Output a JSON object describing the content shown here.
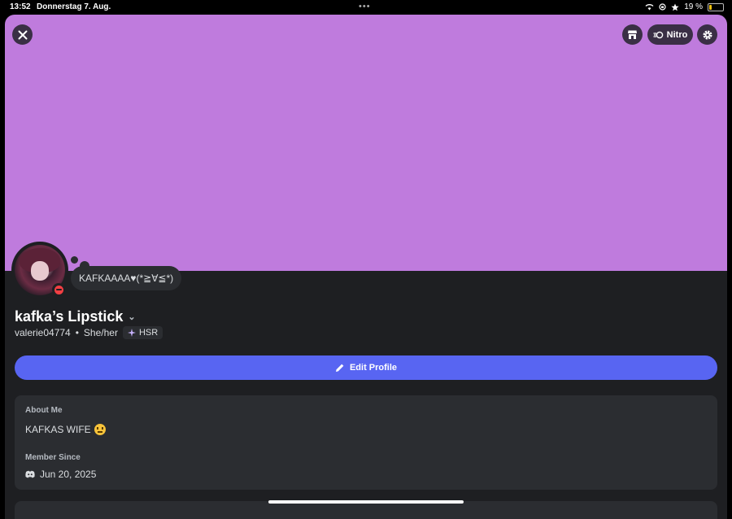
{
  "status_bar": {
    "time": "13:52",
    "date": "Donnerstag 7. Aug.",
    "battery": "19 %"
  },
  "header": {
    "nitro_label": "Nitro"
  },
  "profile": {
    "custom_status": "KAFKAAAA♥(*≧∀≦*)",
    "display_name": "kafka’s Lipstick",
    "username": "valerie04774",
    "separator": "•",
    "pronouns": "She/her",
    "tag": "HSR"
  },
  "actions": {
    "edit_profile_label": "Edit Profile"
  },
  "about": {
    "label": "About Me",
    "text": "KAFKAS WIFE"
  },
  "member_since": {
    "label": "Member Since",
    "date": "Jun 20, 2025"
  },
  "colors": {
    "banner": "#bf7bdd",
    "accent": "#5865f2",
    "dnd": "#f23f43",
    "background": "#1e1f22",
    "card": "#2b2d31"
  }
}
